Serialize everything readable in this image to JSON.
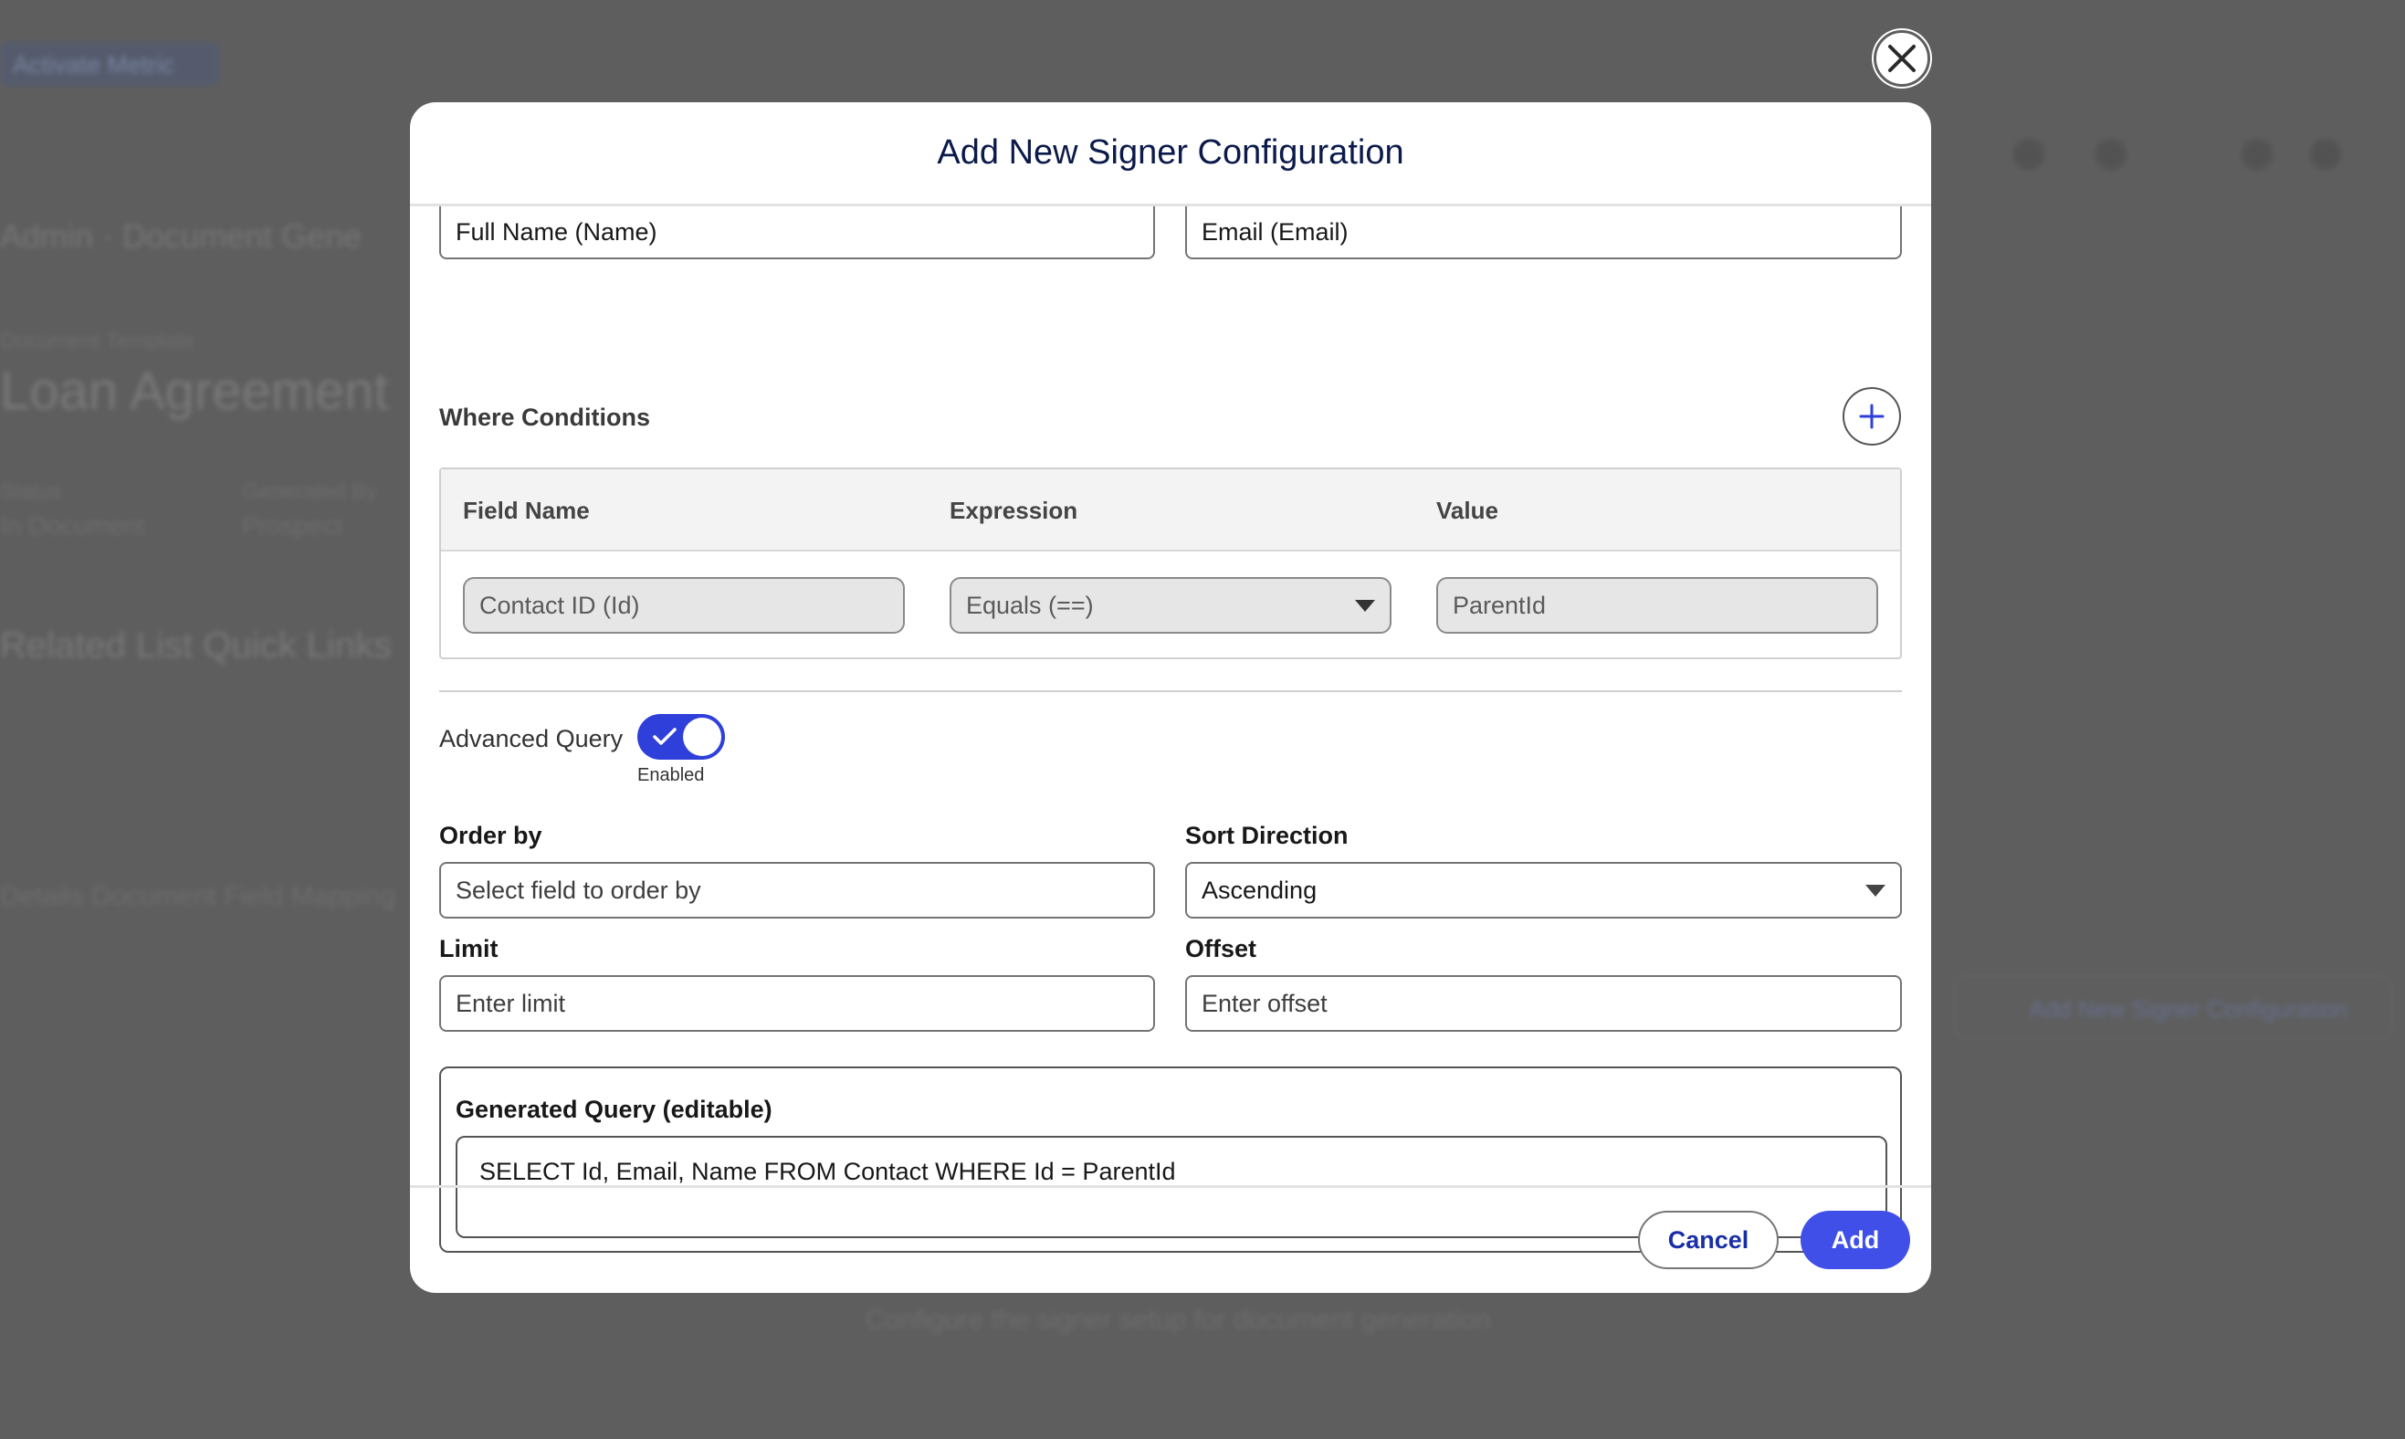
{
  "background": {
    "pill": "Activate Metric",
    "crumb": "Admin  ·  Document Gene",
    "small_label": "Document Template",
    "heading": "Loan Agreement",
    "field1_label": "Status",
    "field1_value": "In Document",
    "field2_label": "Generated By",
    "field2_value": "Prospect",
    "quick_links": "Related List Quick Links",
    "tabs": "Details      Document Field Mapping",
    "right_button": "Add New Signer Configuration",
    "footer_text": "Configure the signer setup for document generation"
  },
  "modal": {
    "title": "Add New Signer Configuration",
    "name_field_value": "Full Name (Name)",
    "email_field_value": "Email (Email)",
    "where_conditions": {
      "title": "Where Conditions",
      "columns": [
        "Field Name",
        "Expression",
        "Value"
      ],
      "row": {
        "field_name": "Contact ID (Id)",
        "expression": "Equals (==)",
        "value": "ParentId"
      }
    },
    "advanced_query": {
      "label": "Advanced Query",
      "status": "Enabled",
      "enabled": true
    },
    "order_by": {
      "label": "Order by",
      "placeholder": "Select field to order by"
    },
    "sort_direction": {
      "label": "Sort Direction",
      "value": "Ascending"
    },
    "limit": {
      "label": "Limit",
      "placeholder": "Enter limit"
    },
    "offset": {
      "label": "Offset",
      "placeholder": "Enter offset"
    },
    "generated_query": {
      "label": "Generated Query (editable)",
      "value": "SELECT Id, Email, Name FROM Contact WHERE Id = ParentId"
    },
    "footer": {
      "cancel_label": "Cancel",
      "add_label": "Add"
    }
  },
  "colors": {
    "primary": "#3f4fe8",
    "toggle": "#2f3fd9",
    "title": "#0b1a4a",
    "backdrop": "#5e5e5e"
  },
  "icons": {
    "close": "close-icon",
    "add": "plus-icon",
    "dropdown": "chevron-down-icon",
    "toggle_check": "check-icon"
  }
}
